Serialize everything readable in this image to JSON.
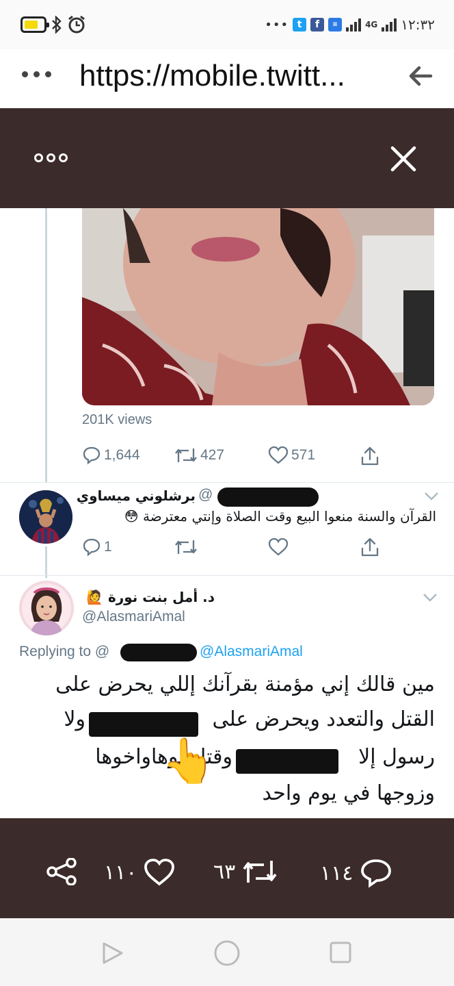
{
  "status_bar": {
    "time": "١٢:٣٢",
    "network": "4G",
    "icons": [
      "battery-icon",
      "bluetooth-icon",
      "alarm-icon",
      "twitter-app-icon",
      "facebook-app-icon",
      "news-app-icon",
      "signal-icon"
    ]
  },
  "browser": {
    "url": "https://mobile.twitt..."
  },
  "tweet": {
    "views": "201K views",
    "replies": "1,644",
    "retweets": "427",
    "likes": "571"
  },
  "reply1": {
    "name": "برشلوني ميساوي",
    "handle_prefix": "@",
    "text": "القرآن والسنة منعوا البيع وقت الصلاة وإنتي معترضة 😳",
    "replies": "1"
  },
  "reply2": {
    "name": "د. أمل بنت نورة 🙋",
    "handle": "@AlasmariAmal",
    "replying_to_label": "Replying to @",
    "replying_to_handle": "@AlasmariAmal",
    "lines": [
      "مين قالك إني مؤمنة بقرآنك إللي يحرض على",
      "القتل والتعدد ويحرض على ",
      "رسول إلا ",
      "وزوجها في يوم واحد"
    ],
    "line2_end": "ولا",
    "line3_end": "وقتل بوهاواخوها",
    "hand_emoji": "👆"
  },
  "viewer_bottom": {
    "likes": "١١٠",
    "retweets": "٦٣",
    "replies": "١١٤"
  },
  "colors": {
    "viewer_bg": "#3b2b2a",
    "secondary_text": "#657786",
    "link_blue": "#1da1f2"
  }
}
